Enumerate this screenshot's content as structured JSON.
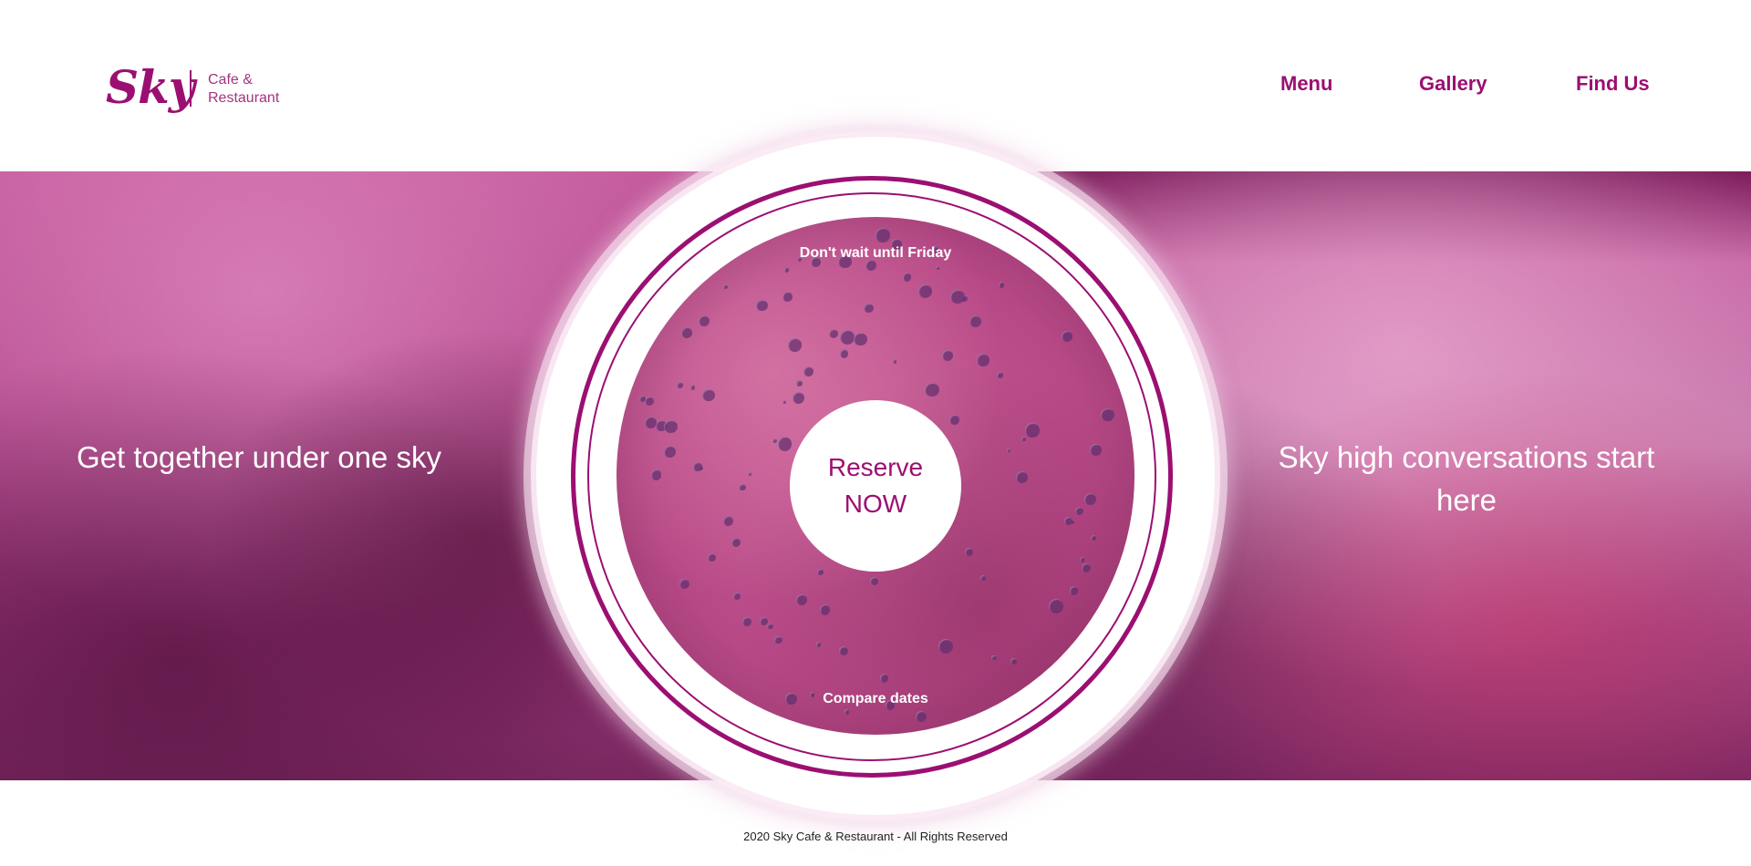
{
  "brand": {
    "logo": "Sky",
    "tagline_line1": "Cafe &",
    "tagline_line2": "Restaurant",
    "color": "#9b0f72"
  },
  "nav": {
    "items": [
      {
        "label": "Menu"
      },
      {
        "label": "Gallery"
      },
      {
        "label": "Find Us"
      }
    ]
  },
  "hero": {
    "left_text": "Get together under one sky",
    "right_text": "Sky high conversations start here",
    "circle": {
      "top_text": "Don't wait until Friday",
      "cta_line1": "Reserve",
      "cta_line2": "NOW",
      "bottom_text": "Compare dates"
    }
  },
  "footer": {
    "text": "2020 Sky Cafe & Restaurant - All Rights Reserved"
  }
}
